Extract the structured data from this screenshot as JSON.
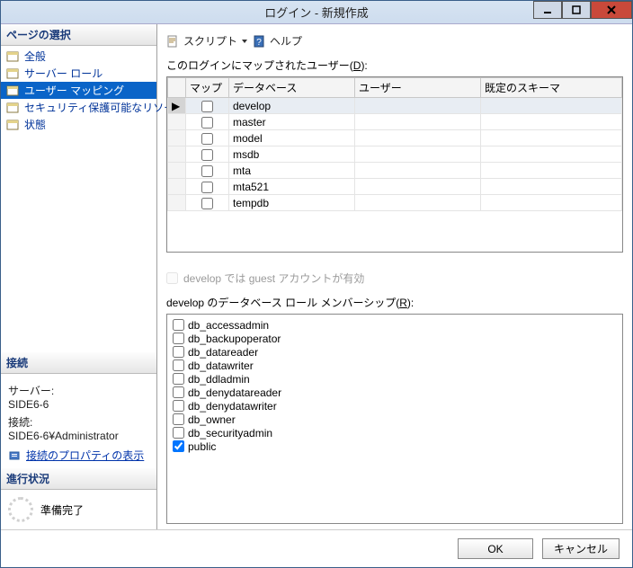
{
  "window": {
    "title": "ログイン - 新規作成"
  },
  "left": {
    "pages_header": "ページの選択",
    "pages": [
      {
        "label": "全般"
      },
      {
        "label": "サーバー ロール"
      },
      {
        "label": "ユーザー マッピング"
      },
      {
        "label": "セキュリティ保護可能なリソース"
      },
      {
        "label": "状態"
      }
    ],
    "connection_header": "接続",
    "server_label": "サーバー:",
    "server_value": "SIDE6-6",
    "conn_label": "接続:",
    "conn_value": "SIDE6-6¥Administrator",
    "conn_link": "接続のプロパティの表示",
    "progress_header": "進行状況",
    "progress_status": "準備完了"
  },
  "toolbar": {
    "script": "スクリプト",
    "help": "ヘルプ"
  },
  "main": {
    "mapped_users_label_pre": "このログインにマップされたユーザー(",
    "mapped_users_label_key": "D",
    "mapped_users_label_post": "):",
    "columns": {
      "map": "マップ",
      "database": "データベース",
      "user": "ユーザー",
      "schema": "既定のスキーマ"
    },
    "rows": [
      {
        "db": "develop",
        "selected": true
      },
      {
        "db": "master"
      },
      {
        "db": "model"
      },
      {
        "db": "msdb"
      },
      {
        "db": "mta"
      },
      {
        "db": "mta521"
      },
      {
        "db": "tempdb"
      }
    ],
    "guest_label": "develop では guest アカウントが有効",
    "roles_label_pre": "develop のデータベース ロール メンバーシップ(",
    "roles_label_key": "R",
    "roles_label_post": "):",
    "roles": [
      {
        "name": "db_accessadmin",
        "checked": false
      },
      {
        "name": "db_backupoperator",
        "checked": false
      },
      {
        "name": "db_datareader",
        "checked": false
      },
      {
        "name": "db_datawriter",
        "checked": false
      },
      {
        "name": "db_ddladmin",
        "checked": false
      },
      {
        "name": "db_denydatareader",
        "checked": false
      },
      {
        "name": "db_denydatawriter",
        "checked": false
      },
      {
        "name": "db_owner",
        "checked": false
      },
      {
        "name": "db_securityadmin",
        "checked": false
      },
      {
        "name": "public",
        "checked": true
      }
    ]
  },
  "footer": {
    "ok": "OK",
    "cancel": "キャンセル"
  }
}
